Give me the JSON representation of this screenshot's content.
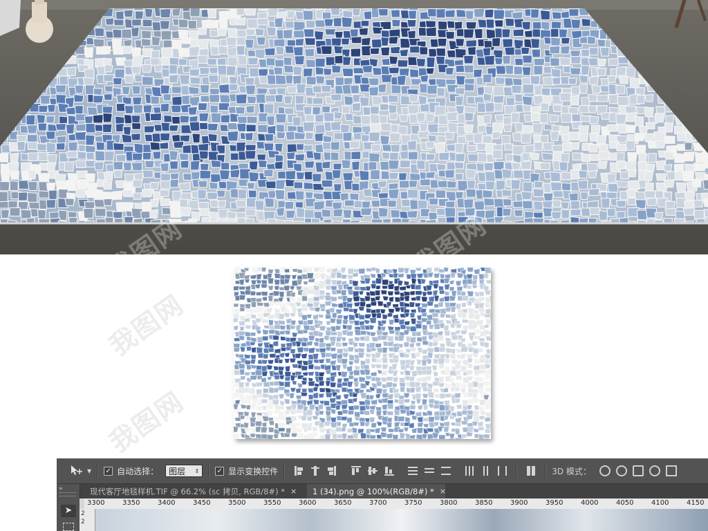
{
  "watermarks": [
    "我图网",
    "我图网",
    "我图网",
    "我图网"
  ],
  "photoshop": {
    "options_bar": {
      "tool_icon": "move-tool-icon",
      "auto_select_label": "自动选择：",
      "auto_select_checked": true,
      "layer_select_value": "图层",
      "show_transform_label": "显示变换控件",
      "show_transform_checked": true,
      "mode_label": "3D 模式："
    },
    "tabs": [
      {
        "label": "现代客厅地毯样机.TIF @ 66.2% (sc 拷贝, RGB/8#) *",
        "close": "×",
        "active": false
      },
      {
        "label": "1 (34).png @ 100%(RGB/8#) *",
        "close": "×",
        "active": true
      }
    ],
    "ruler_ticks": [
      "3300",
      "3350",
      "3400",
      "3450",
      "3500",
      "3550",
      "3600",
      "3650",
      "3700",
      "3750",
      "3800",
      "3850",
      "3900",
      "3950",
      "4000",
      "4050",
      "4100",
      "4150"
    ],
    "left_ruler": [
      "2",
      "2"
    ],
    "toolbar_top": "»"
  }
}
